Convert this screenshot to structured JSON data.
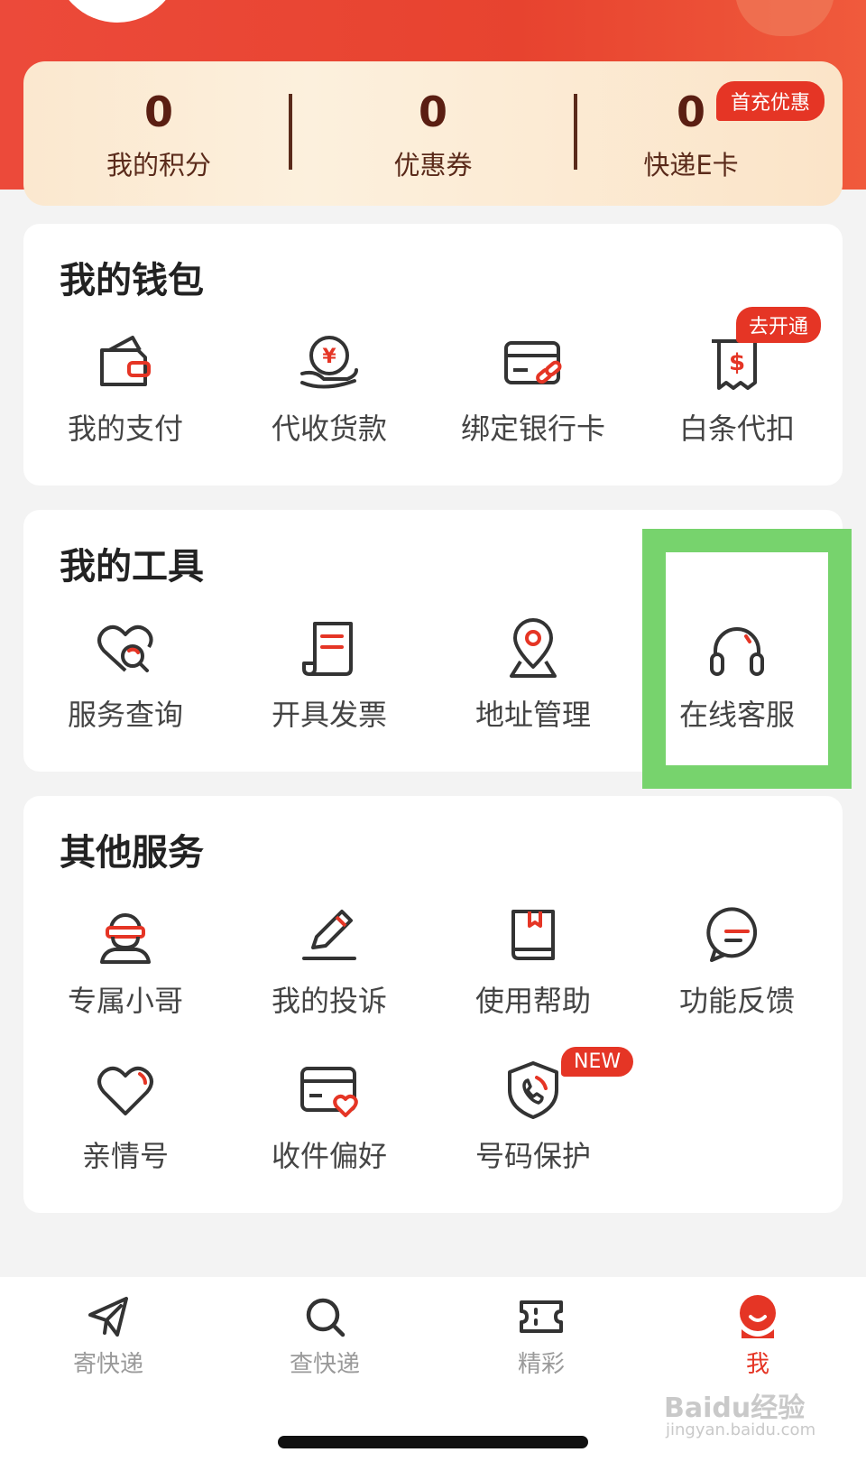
{
  "summary": {
    "points": {
      "value": "0",
      "label": "我的积分"
    },
    "coupons": {
      "value": "0",
      "label": "优惠券"
    },
    "ecard": {
      "value": "0",
      "label": "快递E卡",
      "badge": "首充优惠"
    }
  },
  "wallet": {
    "title": "我的钱包",
    "items": [
      {
        "label": "我的支付",
        "icon": "wallet-icon"
      },
      {
        "label": "代收货款",
        "icon": "cash-hand-icon"
      },
      {
        "label": "绑定银行卡",
        "icon": "card-link-icon"
      },
      {
        "label": "白条代扣",
        "icon": "receipt-dollar-icon",
        "badge": "去开通"
      }
    ]
  },
  "tools": {
    "title": "我的工具",
    "items": [
      {
        "label": "服务查询",
        "icon": "heart-search-icon"
      },
      {
        "label": "开具发票",
        "icon": "invoice-icon"
      },
      {
        "label": "地址管理",
        "icon": "location-pin-icon"
      },
      {
        "label": "在线客服",
        "icon": "headset-icon"
      }
    ]
  },
  "other": {
    "title": "其他服务",
    "items": [
      {
        "label": "专属小哥",
        "icon": "courier-icon"
      },
      {
        "label": "我的投诉",
        "icon": "pencil-icon"
      },
      {
        "label": "使用帮助",
        "icon": "book-icon"
      },
      {
        "label": "功能反馈",
        "icon": "chat-bubble-icon"
      },
      {
        "label": "亲情号",
        "icon": "heart-icon"
      },
      {
        "label": "收件偏好",
        "icon": "card-heart-icon"
      },
      {
        "label": "号码保护",
        "icon": "shield-phone-icon",
        "badge": "NEW"
      }
    ]
  },
  "tabbar": [
    {
      "label": "寄快递",
      "icon": "send-icon"
    },
    {
      "label": "查快递",
      "icon": "search-icon"
    },
    {
      "label": "精彩",
      "icon": "ticket-icon"
    },
    {
      "label": "我",
      "icon": "profile-icon",
      "active": true
    }
  ],
  "watermark": {
    "line1": "Baidu经验",
    "line2": "jingyan.baidu.com"
  },
  "colors": {
    "accent": "#e53525",
    "highlight": "#77d36d",
    "header": "#ec4a3a"
  }
}
